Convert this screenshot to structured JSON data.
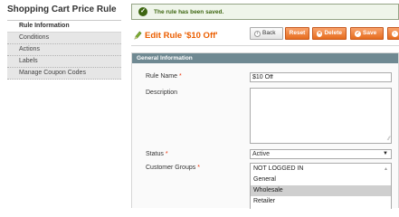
{
  "sidebar": {
    "title": "Shopping Cart Price Rule",
    "tabs": [
      {
        "label": "Rule Information"
      },
      {
        "label": "Conditions"
      },
      {
        "label": "Actions"
      },
      {
        "label": "Labels"
      },
      {
        "label": "Manage Coupon Codes"
      }
    ],
    "active_tab": "Rule Information"
  },
  "message": {
    "text": "The rule has been saved.",
    "icon": "check-icon"
  },
  "header": {
    "title": "Edit Rule '$10 Off'",
    "icon": "edit-pencil-icon",
    "buttons": {
      "back": "Back",
      "reset": "Reset",
      "delete": "Delete",
      "save": "Save"
    }
  },
  "form": {
    "section_title": "General Information",
    "rule_name": {
      "label": "Rule Name",
      "required": "*",
      "value": "$10 Off"
    },
    "description": {
      "label": "Description",
      "value": ""
    },
    "status": {
      "label": "Status",
      "required": "*",
      "value": "Active"
    },
    "customer_groups": {
      "label": "Customer Groups",
      "required": "*",
      "options": [
        "NOT LOGGED IN",
        "General",
        "Wholesale",
        "Retailer"
      ],
      "selected": "Wholesale"
    }
  },
  "colors": {
    "accent_orange": "#eb5e00",
    "section_header": "#6f8992",
    "success_green": "#3d6611"
  }
}
